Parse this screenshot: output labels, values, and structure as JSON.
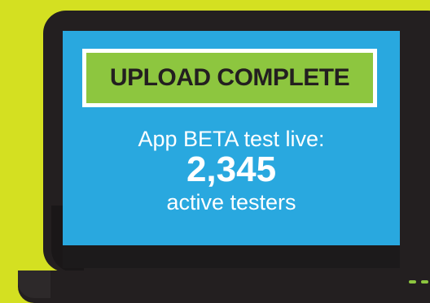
{
  "upload_status": {
    "label": "UPLOAD COMPLETE"
  },
  "beta_message": {
    "headline": "App BETA test live:",
    "tester_count": "2,345",
    "tester_label": "active testers"
  },
  "colors": {
    "background": "#d4e021",
    "laptop_body": "#231f20",
    "screen": "#29a8df",
    "badge_fill": "#8dc63f",
    "badge_border": "#ffffff",
    "text_light": "#ffffff",
    "text_dark": "#231f20"
  },
  "icons": {
    "device": "laptop-icon",
    "indicator": "status-led-icon"
  }
}
